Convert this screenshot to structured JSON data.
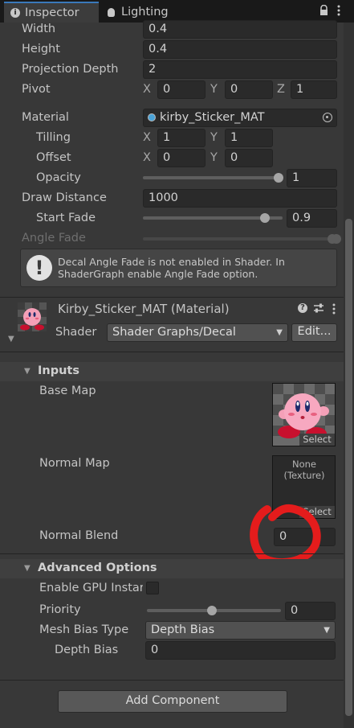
{
  "tabs": [
    {
      "label": "Inspector",
      "icon": "info-icon"
    },
    {
      "label": "Lighting",
      "icon": "lightbulb-icon"
    }
  ],
  "decal": {
    "width": {
      "label": "Width",
      "value": "0.4"
    },
    "height": {
      "label": "Height",
      "value": "0.4"
    },
    "projection_depth": {
      "label": "Projection Depth",
      "value": "2"
    },
    "pivot": {
      "label": "Pivot",
      "x_label": "X",
      "x": "0",
      "y_label": "Y",
      "y": "0",
      "z_label": "Z",
      "z": "1"
    },
    "material": {
      "label": "Material",
      "value": "kirby_Sticker_MAT"
    },
    "tilling": {
      "label": "Tilling",
      "x_label": "X",
      "x": "1",
      "y_label": "Y",
      "y": "1"
    },
    "offset": {
      "label": "Offset",
      "x_label": "X",
      "x": "0",
      "y_label": "Y",
      "y": "0"
    },
    "opacity": {
      "label": "Opacity",
      "value": "1",
      "slider_fraction": 1.0
    },
    "draw_distance": {
      "label": "Draw Distance",
      "value": "1000"
    },
    "start_fade": {
      "label": "Start Fade",
      "value": "0.9",
      "slider_fraction": 0.9
    },
    "angle_fade": {
      "label": "Angle Fade"
    },
    "warning_text": "Decal Angle Fade is not enabled in Shader. In ShaderGraph enable Angle Fade option."
  },
  "material_header": {
    "title": "Kirby_Sticker_MAT (Material)",
    "shader_label": "Shader",
    "shader_value": "Shader Graphs/Decal",
    "edit_button": "Edit..."
  },
  "inputs": {
    "header": "Inputs",
    "base_map": {
      "label": "Base Map",
      "select": "Select"
    },
    "normal_map": {
      "label": "Normal Map",
      "none_text": "None (Texture)",
      "select": "Select"
    },
    "normal_blend": {
      "label": "Normal Blend",
      "value": "0"
    }
  },
  "advanced": {
    "header": "Advanced Options",
    "gpu_instancing": {
      "label": "Enable GPU Instar"
    },
    "priority": {
      "label": "Priority",
      "value": "0",
      "slider_fraction": 0.5
    },
    "mesh_bias_type": {
      "label": "Mesh Bias Type",
      "value": "Depth Bias"
    },
    "depth_bias": {
      "label": "Depth Bias",
      "value": "0"
    }
  },
  "add_component": "Add Component",
  "colors": {
    "annotation": "#e41c1c",
    "tab_accent": "#3a79bb"
  }
}
